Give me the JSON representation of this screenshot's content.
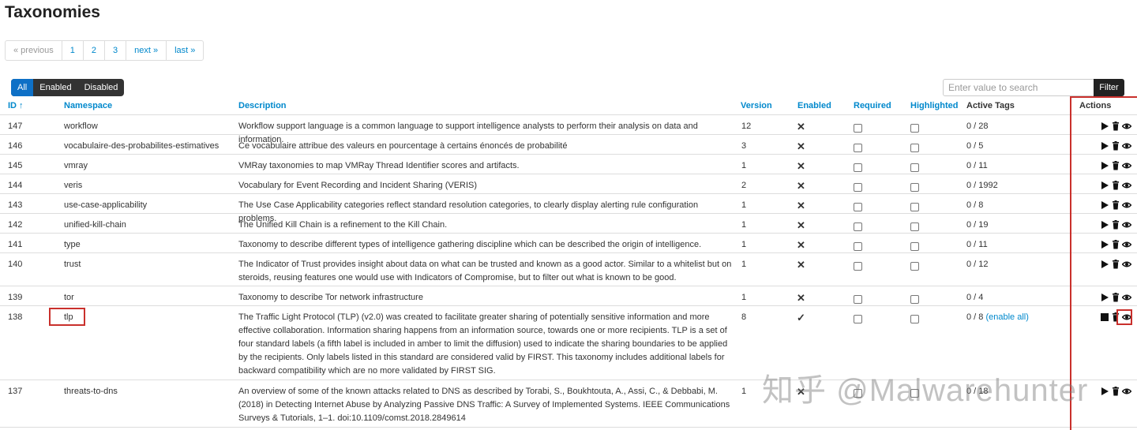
{
  "page": {
    "title": "Taxonomies"
  },
  "pagination": {
    "previous": "« previous",
    "pages": [
      "1",
      "2",
      "3"
    ],
    "next": "next »",
    "last": "last »"
  },
  "filter_tabs": [
    "All",
    "Enabled",
    "Disabled"
  ],
  "search": {
    "placeholder": "Enter value to search",
    "button": "Filter"
  },
  "table": {
    "headers": {
      "id": "ID ↑",
      "namespace": "Namespace",
      "description": "Description",
      "version": "Version",
      "enabled": "Enabled",
      "required": "Required",
      "highlighted": "Highlighted",
      "active_tags": "Active Tags",
      "actions": "Actions"
    },
    "rows": [
      {
        "id": "147",
        "namespace": "workflow",
        "description": "Workflow support language is a common language to support intelligence analysts to perform their analysis on data and information.",
        "version": "12",
        "enabled": "✕",
        "active_tags": "0 / 28",
        "enable_all": ""
      },
      {
        "id": "146",
        "namespace": "vocabulaire-des-probabilites-estimatives",
        "description": "Ce vocabulaire attribue des valeurs en pourcentage à certains énoncés de probabilité",
        "version": "3",
        "enabled": "✕",
        "active_tags": "0 / 5",
        "enable_all": ""
      },
      {
        "id": "145",
        "namespace": "vmray",
        "description": "VMRay taxonomies to map VMRay Thread Identifier scores and artifacts.",
        "version": "1",
        "enabled": "✕",
        "active_tags": "0 / 11",
        "enable_all": ""
      },
      {
        "id": "144",
        "namespace": "veris",
        "description": "Vocabulary for Event Recording and Incident Sharing (VERIS)",
        "version": "2",
        "enabled": "✕",
        "active_tags": "0 / 1992",
        "enable_all": ""
      },
      {
        "id": "143",
        "namespace": "use-case-applicability",
        "description": "The Use Case Applicability categories reflect standard resolution categories, to clearly display alerting rule configuration problems.",
        "version": "1",
        "enabled": "✕",
        "active_tags": "0 / 8",
        "enable_all": ""
      },
      {
        "id": "142",
        "namespace": "unified-kill-chain",
        "description": "The Unified Kill Chain is a refinement to the Kill Chain.",
        "version": "1",
        "enabled": "✕",
        "active_tags": "0 / 19",
        "enable_all": ""
      },
      {
        "id": "141",
        "namespace": "type",
        "description": "Taxonomy to describe different types of intelligence gathering discipline which can be described the origin of intelligence.",
        "version": "1",
        "enabled": "✕",
        "active_tags": "0 / 11",
        "enable_all": ""
      },
      {
        "id": "140",
        "namespace": "trust",
        "description": "The Indicator of Trust provides insight about data on what can be trusted and known as a good actor. Similar to a whitelist but on steroids, reusing features one would use with Indicators of Compromise, but to filter out what is known to be good.",
        "version": "1",
        "enabled": "✕",
        "active_tags": "0 / 12",
        "enable_all": ""
      },
      {
        "id": "139",
        "namespace": "tor",
        "description": "Taxonomy to describe Tor network infrastructure",
        "version": "1",
        "enabled": "✕",
        "active_tags": "0 / 4",
        "enable_all": ""
      },
      {
        "id": "138",
        "namespace": "tlp",
        "description": "The Traffic Light Protocol (TLP) (v2.0) was created to facilitate greater sharing of potentially sensitive information and more effective collaboration. Information sharing happens from an information source, towards one or more recipients. TLP is a set of four standard labels (a fifth label is included in amber to limit the diffusion) used to indicate the sharing boundaries to be applied by the recipients. Only labels listed in this standard are considered valid by FIRST. This taxonomy includes additional labels for backward compatibility which are no more validated by FIRST SIG.",
        "version": "8",
        "enabled": "✓",
        "active_tags": "0 / 8",
        "enable_all": "(enable all)"
      },
      {
        "id": "137",
        "namespace": "threats-to-dns",
        "description": "An overview of some of the known attacks related to DNS as described by Torabi, S., Boukhtouta, A., Assi, C., & Debbabi, M. (2018) in Detecting Internet Abuse by Analyzing Passive DNS Traffic: A Survey of Implemented Systems. IEEE Communications Surveys & Tutorials, 1–1. doi:10.1109/comst.2018.2849614",
        "version": "1",
        "enabled": "✕",
        "active_tags": "0 / 18",
        "enable_all": ""
      }
    ]
  },
  "watermark": "知乎 @Malwarehunter",
  "colors": {
    "link": "#0088cc",
    "highlight_box": "#c9302c",
    "active_tab": "#0e70c6"
  }
}
